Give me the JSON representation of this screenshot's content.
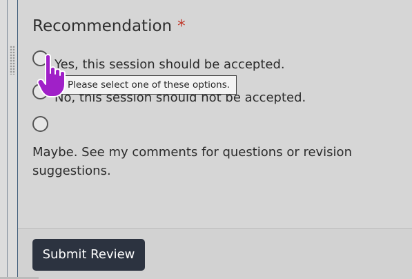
{
  "question": {
    "title": "Recommendation",
    "required_mark": "*"
  },
  "options": [
    {
      "label": "Yes, this session should be accepted.",
      "selected": false
    },
    {
      "label": "No, this session should not be accepted.",
      "selected": false
    },
    {
      "label": "Maybe. See my comments for questions or revision suggestions.",
      "selected": false
    }
  ],
  "validation": {
    "tooltip": "Please select one of these options."
  },
  "footer": {
    "submit_label": "Submit Review"
  },
  "colors": {
    "background": "#d6d6d6",
    "required": "#c0392b",
    "button_bg": "#2c3340",
    "button_text": "#ffffff",
    "cursor": "#a020c8"
  },
  "icons": {
    "cursor": "hand-pointer-icon",
    "drag": "drag-handle-icon"
  }
}
